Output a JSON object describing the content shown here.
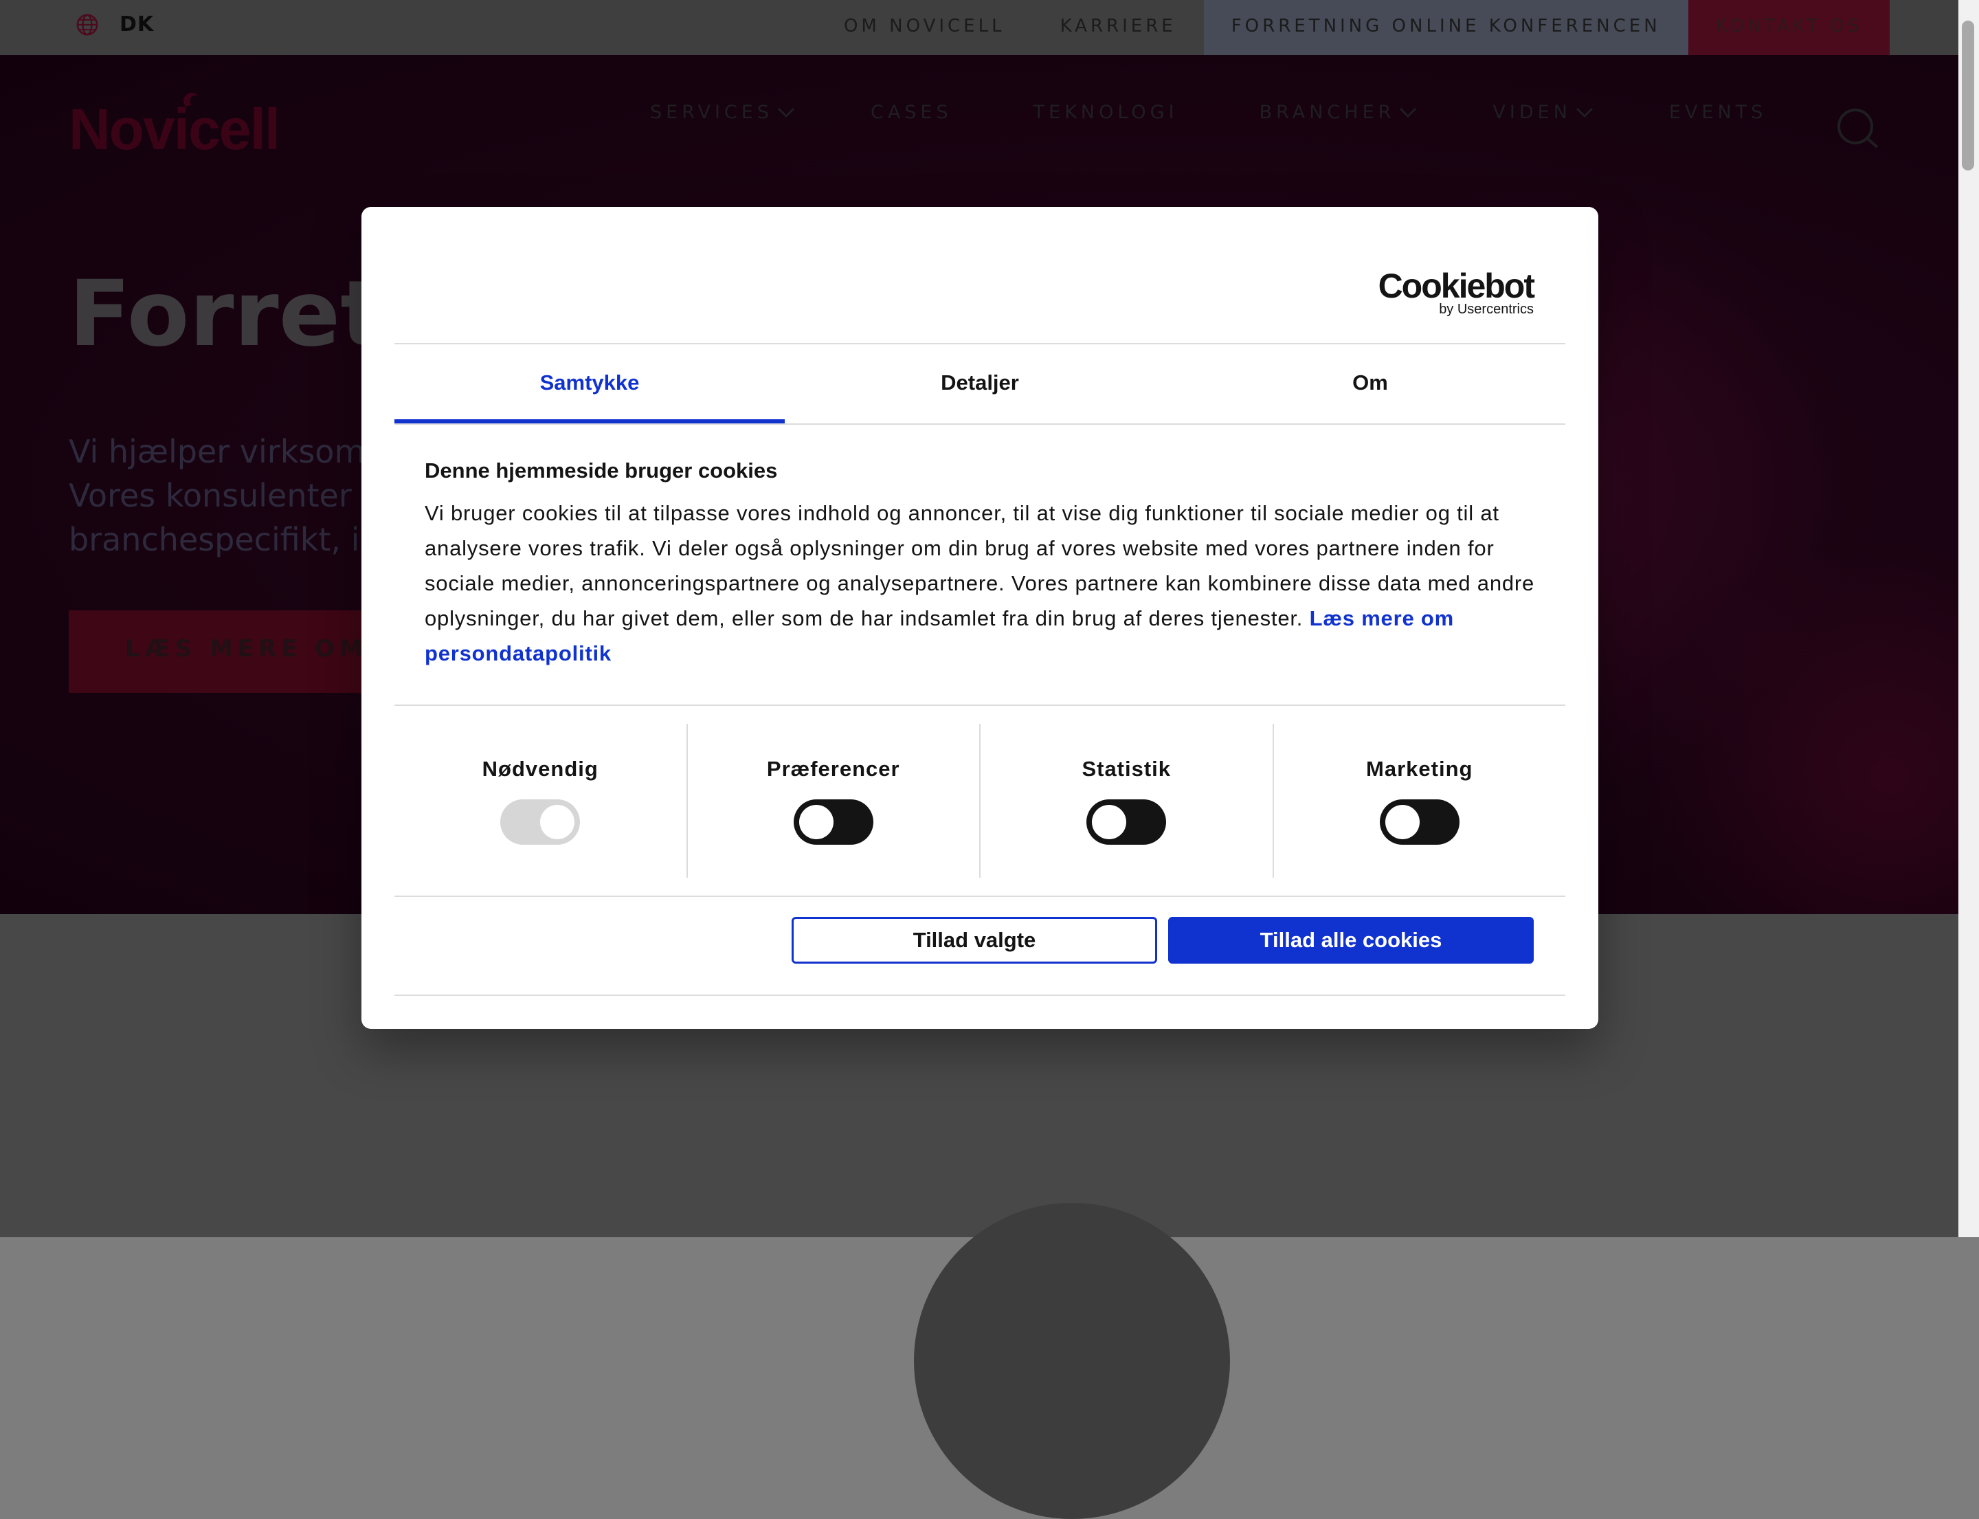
{
  "utility_bar": {
    "language": "DK",
    "links": [
      "OM NOVICELL",
      "KARRIERE",
      "FORRETNING ONLINE KONFERENCEN",
      "KONTAKT OS"
    ]
  },
  "header": {
    "logo_text": "Novicell",
    "nav": [
      "SERVICES",
      "CASES",
      "TEKNOLOGI",
      "BRANCHER",
      "VIDEN",
      "EVENTS"
    ]
  },
  "hero": {
    "title": "Forretn",
    "text_lines": [
      "Vi hjælper virksomh",
      "Vores konsulenter ir",
      "branchespecifikt, i"
    ],
    "cta": "LÆS MERE OM H"
  },
  "cookie_dialog": {
    "brand": "Cookiebot",
    "brand_sub": "by Usercentrics",
    "tabs": [
      "Samtykke",
      "Detaljer",
      "Om"
    ],
    "heading": "Denne hjemmeside bruger cookies",
    "body": "Vi bruger cookies til at tilpasse vores indhold og annoncer, til at vise dig funktioner til sociale medier og til at analysere vores trafik. Vi deler også oplysninger om din brug af vores website med vores partnere inden for sociale medier, annonceringspartnere og analysepartnere. Vores partnere kan kombinere disse data med andre oplysninger, du har givet dem, eller som de har indsamlet fra din brug af deres tjenester.",
    "link": "Læs mere om persondatapolitik",
    "toggles": [
      {
        "label": "Nødvendig",
        "on": true,
        "disabled": true
      },
      {
        "label": "Præferencer",
        "on": false
      },
      {
        "label": "Statistik",
        "on": false
      },
      {
        "label": "Marketing",
        "on": false
      }
    ],
    "btn_selected": "Tillad valgte",
    "btn_all": "Tillad alle cookies"
  },
  "colors": {
    "accent_blue": "#1032cf",
    "brand_red": "#e4003a"
  }
}
